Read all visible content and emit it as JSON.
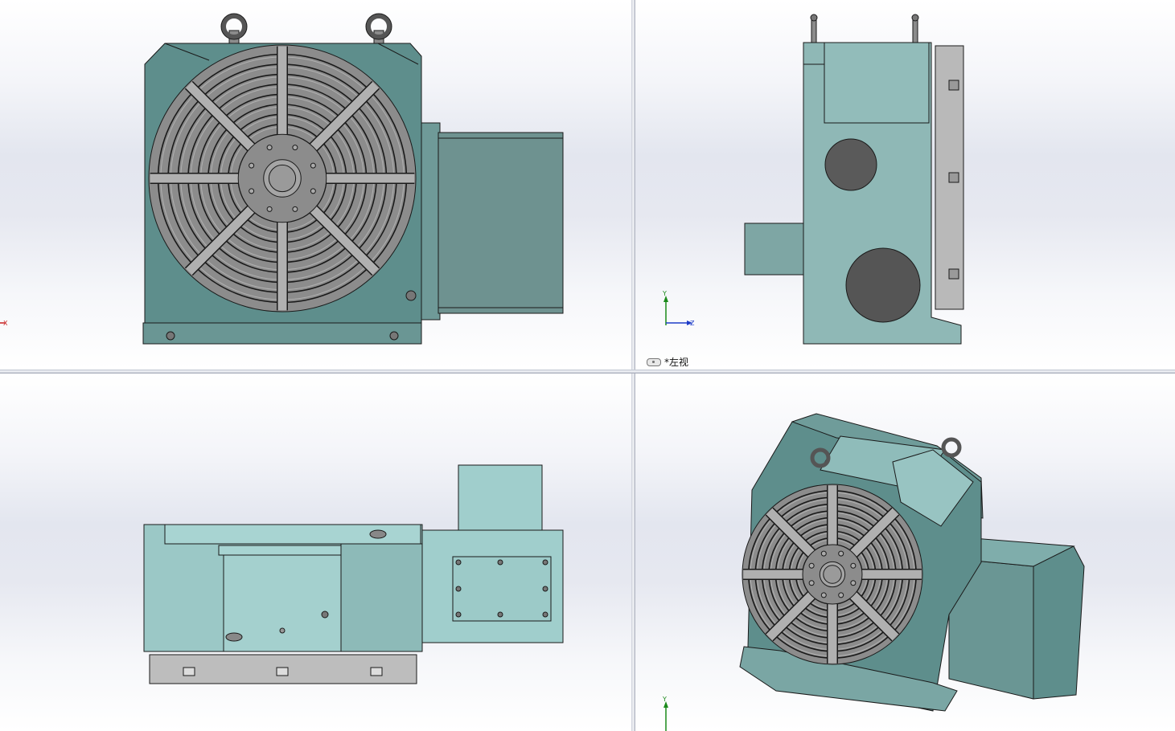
{
  "views": {
    "top_left": {
      "axis": {
        "x": "X"
      }
    },
    "top_right": {
      "label": "*左视",
      "axis": {
        "y": "Y",
        "z": "Z"
      }
    },
    "bottom_right": {
      "axis": {
        "y": "Y"
      }
    }
  },
  "colors": {
    "body": "#5e8e8c",
    "body_light": "#98c2c0",
    "table": "#8c8c8c",
    "slot": "#b0b0b0",
    "edge": "#1a1a1a",
    "axis_x": "#c81e1e",
    "axis_y": "#1a8a1a",
    "axis_z": "#1e3cc8"
  }
}
